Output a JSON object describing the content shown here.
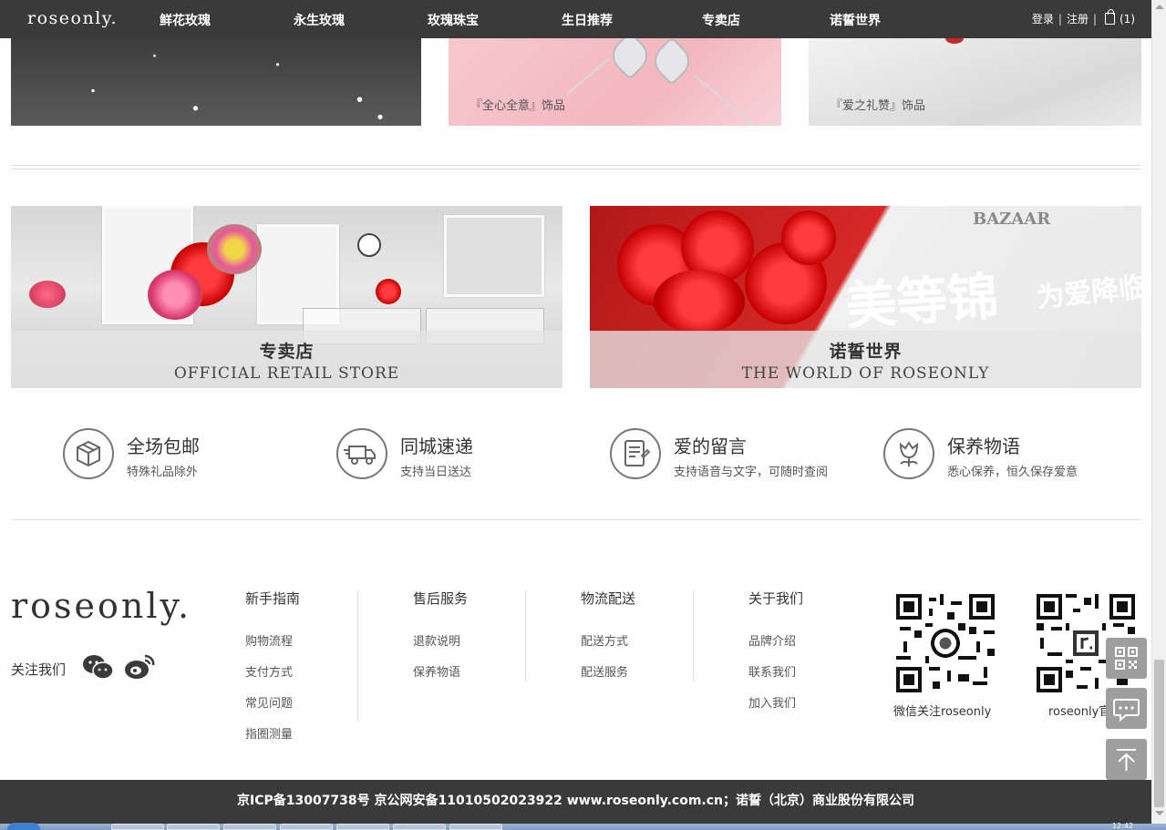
{
  "nav": {
    "logo": "roseonly.",
    "items": [
      "鲜花玫瑰",
      "永生玫瑰",
      "玫瑰珠宝",
      "生日推荐",
      "专卖店",
      "诺誓世界"
    ],
    "login": "登录",
    "register": "注册",
    "sep": "|",
    "cart_count": "(1)"
  },
  "products": [
    {
      "caption": ""
    },
    {
      "caption": "『全心全意』饰品"
    },
    {
      "caption": "『爱之礼赞』饰品"
    }
  ],
  "banners": {
    "store": {
      "cn": "专卖店",
      "en": "OFFICIAL RETAIL STORE"
    },
    "world": {
      "cn": "诺誓世界",
      "en": "THE WORLD OF ROSEONLY",
      "bazaar": "BAZAAR",
      "calligraphy": "美等锦",
      "calligraphy2": "为爱降临"
    }
  },
  "services": [
    {
      "title": "全场包邮",
      "sub": "特殊礼品除外",
      "icon": "package-box-icon"
    },
    {
      "title": "同城速递",
      "sub": "支持当日送达",
      "icon": "delivery-truck-icon"
    },
    {
      "title": "爱的留言",
      "sub": "支持语音与文字，可随时查阅",
      "icon": "message-note-icon"
    },
    {
      "title": "保养物语",
      "sub": "悉心保养，恒久保存爱意",
      "icon": "rose-care-icon"
    }
  ],
  "footer": {
    "logo": "roseonly.",
    "follow": "关注我们",
    "columns": [
      {
        "title": "新手指南",
        "links": [
          "购物流程",
          "支付方式",
          "常见问题",
          "指圈测量"
        ]
      },
      {
        "title": "售后服务",
        "links": [
          "退款说明",
          "保养物语"
        ]
      },
      {
        "title": "物流配送",
        "links": [
          "配送方式",
          "配送服务"
        ]
      },
      {
        "title": "关于我们",
        "links": [
          "品牌介绍",
          "联系我们",
          "加入我们"
        ]
      }
    ],
    "qr": [
      {
        "label": "微信关注roseonly"
      },
      {
        "label": "roseonly官"
      }
    ]
  },
  "icp": "京ICP备13007738号 京公网安备11010502023922 www.roseonly.com.cn；诺誓（北京）商业股份有限公司",
  "taskbar": {
    "clock": "12:42"
  }
}
